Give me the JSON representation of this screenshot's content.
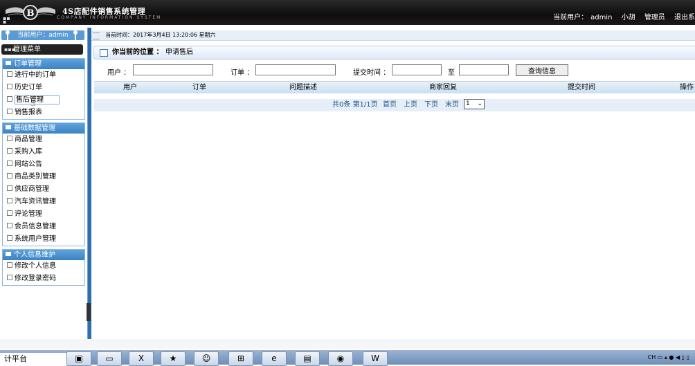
{
  "header": {
    "title": "4S店配件销售系统管理",
    "subtitle": "COMPANY INFORMATION SYSTEM",
    "current_user_label": "当前用户：",
    "current_user": "admin",
    "user_name": "小胡",
    "role": "管理员",
    "logout": "退出系统"
  },
  "sidebar": {
    "current_user": "当前用户：admin",
    "menu_title": "管理菜单",
    "groups": [
      {
        "title": "订单管理",
        "items": [
          "进行中的订单",
          "历史订单",
          "售后管理",
          "销售报表"
        ]
      },
      {
        "title": "基础数据管理",
        "items": [
          "商品管理",
          "采购入库",
          "网站公告",
          "商品类别管理",
          "供应商管理",
          "汽车资讯管理",
          "评论管理",
          "会员信息管理",
          "系统用户管理"
        ]
      },
      {
        "title": "个人信息维护",
        "items": [
          "修改个人信息",
          "修改登录密码"
        ]
      }
    ]
  },
  "topbar": {
    "time": "当前时间：2017年3月4日 13:20:06 星期六"
  },
  "location": {
    "label": "你当前的位置 ：",
    "page": "申请售后"
  },
  "search": {
    "user_label": "用户 ：",
    "user_value": "",
    "order_label": "订单 ：",
    "order_value": "",
    "time_label": "提交时间 ：",
    "time_from": "",
    "to_label": "至",
    "time_to": "",
    "button": "查询信息"
  },
  "table": {
    "columns": [
      "用户",
      "订单",
      "问题描述",
      "商家回复",
      "提交时间",
      "操作"
    ]
  },
  "pager": {
    "summary": "共0条 第1/1页",
    "first": "首页",
    "prev": "上页",
    "next": "下页",
    "last": "末页",
    "page": "1"
  },
  "taskbar": {
    "start": "计平台",
    "tray_lang": "CH"
  }
}
